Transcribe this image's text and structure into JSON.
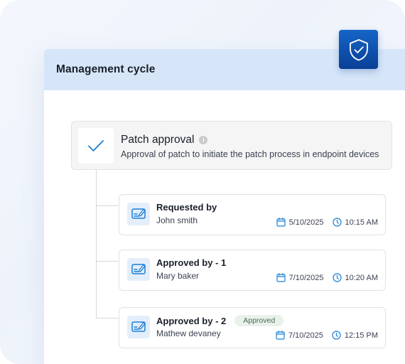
{
  "panel": {
    "title": "Management cycle"
  },
  "patch": {
    "title": "Patch approval",
    "description": "Approval of patch to initiate the patch process in endpoint devices",
    "info_glyph": "i"
  },
  "steps": [
    {
      "title": "Requested by",
      "name": "John smith",
      "date": "5/10/2025",
      "time": "10:15 AM",
      "badge": ""
    },
    {
      "title": "Approved by - 1",
      "name": "Mary baker",
      "date": "7/10/2025",
      "time": "10:20 AM",
      "badge": ""
    },
    {
      "title": "Approved by - 2",
      "name": "Mathew devaney",
      "date": "7/10/2025",
      "time": "12:15 PM",
      "badge": "Approved"
    }
  ],
  "icons": {
    "shield": "shield-check-icon",
    "check": "checkmark-icon",
    "step": "signature-document-icon",
    "date": "calendar-icon",
    "time": "clock-icon"
  },
  "colors": {
    "accent": "#1b7fd6",
    "header_bg": "#d6e6f8",
    "shield_bg": "#0f52b5",
    "badge_bg": "#e8f1ea",
    "badge_text": "#4c6a57"
  }
}
